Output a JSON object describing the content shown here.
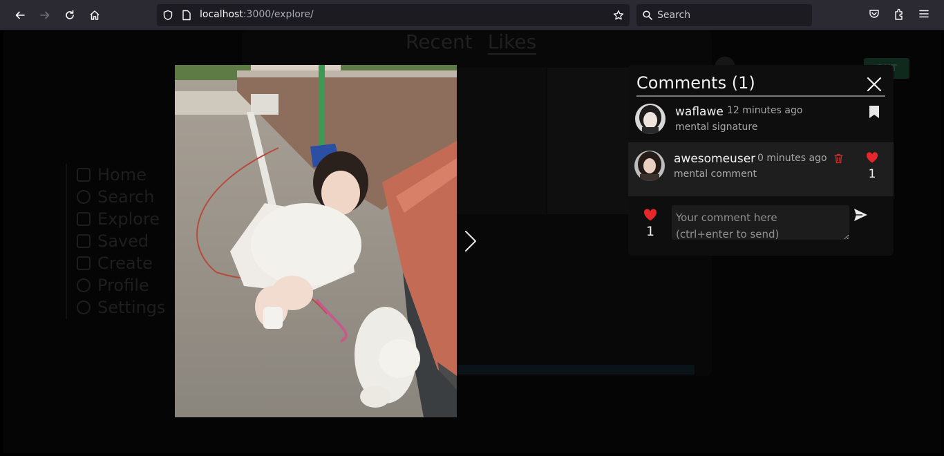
{
  "browser": {
    "url_host": "localhost",
    "url_path": ":3000/explore/",
    "search_placeholder": "Search"
  },
  "background": {
    "tabs": [
      "Recent",
      "Likes"
    ],
    "logout_label": "OUT",
    "nav_items": [
      "Home",
      "Search",
      "Explore",
      "Saved",
      "Create",
      "Profile",
      "Settings"
    ]
  },
  "comments": {
    "title": "Comments",
    "count_label": "(1)",
    "post": {
      "username": "waflawe",
      "time": "12 minutes ago",
      "text": "mental signature"
    },
    "items": [
      {
        "username": "awesomeuser",
        "time": "0 minutes ago",
        "text": "mental comment",
        "likes": "1"
      }
    ],
    "post_likes": "1",
    "input_placeholder": "Your comment here\n(ctrl+enter to send)"
  },
  "colors": {
    "heart": "#e5262b",
    "trash": "#d42a2a",
    "panel": "#0e0e0e"
  },
  "icons": [
    "back-icon",
    "forward-icon",
    "reload-icon",
    "home-icon",
    "shield-icon",
    "page-icon",
    "star-icon",
    "search-icon",
    "pocket-icon",
    "extensions-icon",
    "menu-icon",
    "close-icon",
    "bookmark-icon",
    "trash-icon",
    "heart-icon",
    "send-icon",
    "chevron-right-icon"
  ]
}
